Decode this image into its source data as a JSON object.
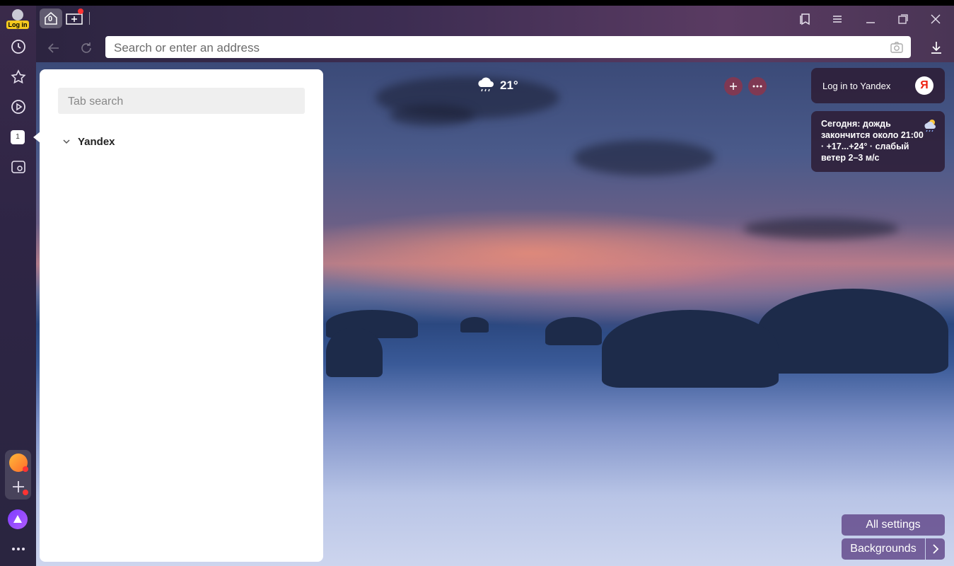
{
  "account": {
    "login_badge": "Log in"
  },
  "tabs": {
    "home_count": "0",
    "open_count": "1"
  },
  "addressbar": {
    "placeholder": "Search or enter an address"
  },
  "tab_panel": {
    "search_placeholder": "Tab search",
    "groups": [
      {
        "label": "Yandex"
      }
    ]
  },
  "weather": {
    "temperature": "21°"
  },
  "login_card": {
    "label": "Log in to Yandex",
    "logo_letter": "Я"
  },
  "forecast": {
    "text": "Сегодня: дождь закончится около 21:00 · +17...+24° · слабый ветер 2–3 м/с"
  },
  "footer_buttons": {
    "all_settings": "All settings",
    "backgrounds": "Backgrounds"
  },
  "colors": {
    "accent": "#e21a1a",
    "sidebar": "#2e2545",
    "button": "#644b8c"
  },
  "icons": [
    "history-icon",
    "bookmarks-star-icon",
    "video-play-icon",
    "screenshot-icon",
    "mail-icon",
    "add-icon",
    "alice-icon",
    "more-icon",
    "collections-icon",
    "menu-icon",
    "minimize-icon",
    "maximize-icon",
    "close-icon",
    "back-icon",
    "reload-icon",
    "camera-icon",
    "download-icon",
    "rain-cloud-icon",
    "plus-icon",
    "dots-icon",
    "chevron-down-icon",
    "chevron-right-icon"
  ]
}
